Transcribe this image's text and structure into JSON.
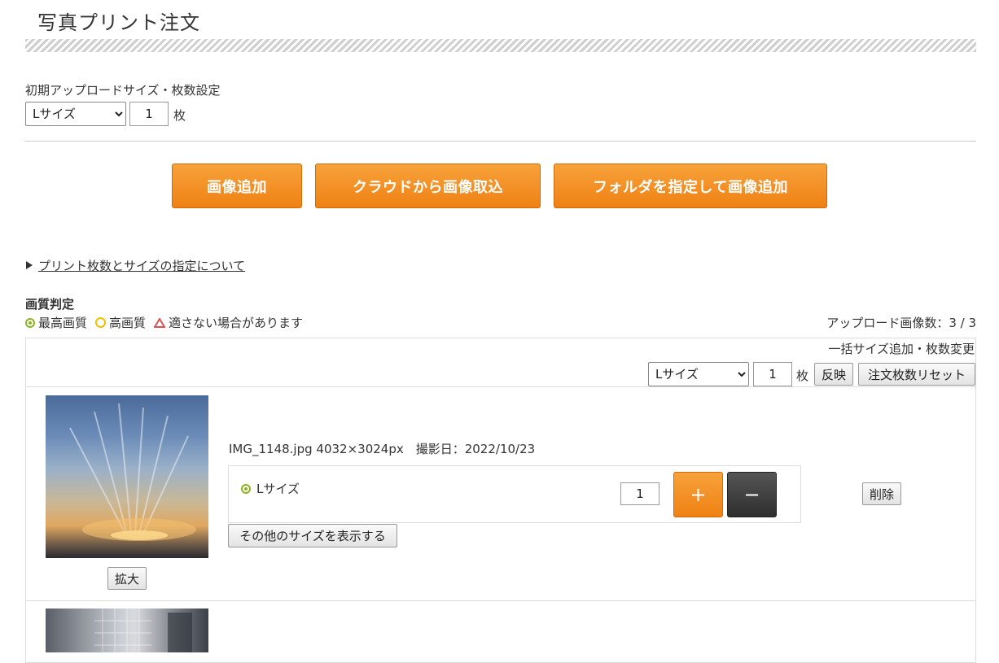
{
  "page": {
    "title": "写真プリント注文"
  },
  "initial_settings": {
    "label": "初期アップロードサイズ・枚数設定",
    "size_select": "Lサイズ",
    "quantity": "1",
    "unit": "枚"
  },
  "buttons": {
    "add_image": "画像追加",
    "cloud_import": "クラウドから画像取込",
    "folder_add": "フォルダを指定して画像追加"
  },
  "help_link": "プリント枚数とサイズの指定について",
  "quality": {
    "heading": "画質判定",
    "best": "最高画質",
    "high": "高画質",
    "warn": "適さない場合があります",
    "colors": {
      "best": "#8bb51e",
      "high": "#f0c000",
      "warn": "#e05050"
    }
  },
  "upload_count": "アップロード画像数：3 / 3",
  "bulk": {
    "label": "一括サイズ追加・枚数変更",
    "size_select": "Lサイズ",
    "quantity": "1",
    "unit": "枚",
    "apply": "反映",
    "reset": "注文枚数リセット"
  },
  "items": [
    {
      "file_info": "IMG_1148.jpg  4032×3024px　撮影日：2022/10/23",
      "size_label": "Lサイズ",
      "quantity": "1",
      "plus": "+",
      "minus": "−",
      "show_more": "その他のサイズを表示する",
      "zoom": "拡大",
      "delete": "削除"
    }
  ],
  "accent_color": "#ef8114"
}
